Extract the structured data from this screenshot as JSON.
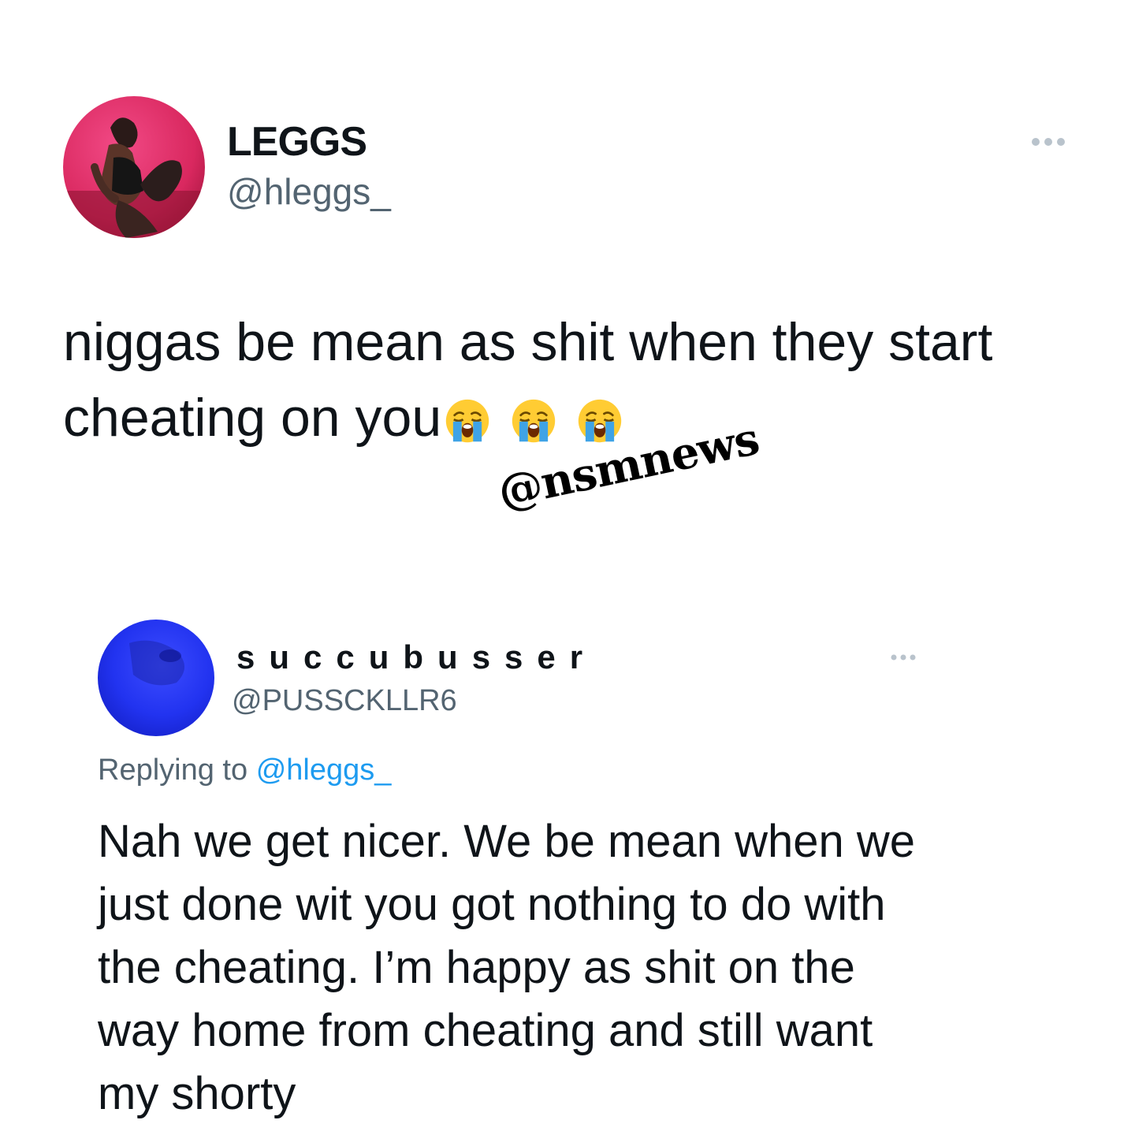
{
  "tweet": {
    "display_name": "LEGGS",
    "handle": "@hleggs_",
    "text": "niggas be mean as shit when they start cheating on you",
    "emojis": [
      "loudly-crying-face",
      "loudly-crying-face",
      "loudly-crying-face"
    ]
  },
  "watermark": "@nsmnews",
  "reply": {
    "display_name": "succubusser",
    "handle": "@PUSSCKLLR6",
    "replying_prefix": "Replying to",
    "replying_to": "@hleggs_",
    "text": "Nah we get nicer. We be mean when we just done wit you got nothing to do with the cheating. I’m happy as shit on the way home from cheating and still want my shorty"
  },
  "colors": {
    "text": "#0f1419",
    "secondary": "#536471",
    "link": "#1d9bf0",
    "background": "#ffffff"
  }
}
